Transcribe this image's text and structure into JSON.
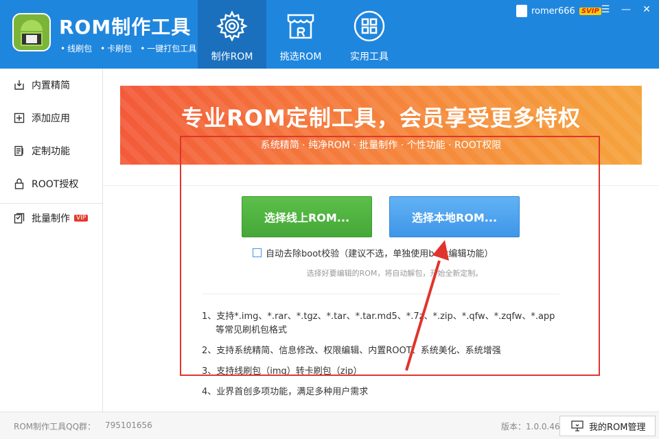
{
  "header": {
    "title": "ROM制作工具",
    "features": [
      "线刷包",
      "卡刷包",
      "一键打包工具"
    ],
    "tabs": [
      {
        "label": "制作ROM",
        "icon": "gear-icon",
        "active": true
      },
      {
        "label": "挑选ROM",
        "icon": "store-icon",
        "active": false
      },
      {
        "label": "实用工具",
        "icon": "grid-icon",
        "active": false
      }
    ],
    "user": {
      "name": "romer666",
      "badge": "SVIP"
    }
  },
  "sidebar": {
    "items": [
      {
        "label": "内置精简",
        "icon": "import-icon"
      },
      {
        "label": "添加应用",
        "icon": "plus-box-icon"
      },
      {
        "label": "定制功能",
        "icon": "document-edit-icon"
      },
      {
        "label": "ROOT授权",
        "icon": "lock-icon"
      },
      {
        "label": "批量制作",
        "icon": "batch-icon",
        "badge": "VIP"
      }
    ]
  },
  "banner": {
    "title": "专业ROM定制工具，会员享受更多特权",
    "subtitle": "系统精简 · 纯净ROM · 批量制作 · 个性功能 · ROOT权限"
  },
  "main": {
    "online_button": "选择线上ROM...",
    "local_button": "选择本地ROM...",
    "checkbox_label": "自动去除boot校验（建议不选，单独使用boot编辑功能）",
    "hint": "选择好要编辑的ROM，将自动解包，开始全新定制。",
    "features": [
      "1、支持*.img、*.rar、*.tgz、*.tar、*.tar.md5、*.7z、*.zip、*.qfw、*.zqfw、*.app",
      "等常见刷机包格式",
      "2、支持系统精简、信息修改、权限编辑、内置ROOT、系统美化、系统增强",
      "3、支持线刷包（img）转卡刷包（zip）",
      "4、业界首创多项功能，满足多种用户需求"
    ]
  },
  "footer": {
    "qq_label": "ROM制作工具QQ群：",
    "qq_number": "795101656",
    "version": "版本：1.0.0.46",
    "manage_button": "我的ROM管理"
  },
  "colors": {
    "header": "#1f86de",
    "active_tab": "#1a70bd",
    "online_btn": "#4cae3c",
    "local_btn": "#4aa0ee",
    "annotation": "#e0342c"
  }
}
